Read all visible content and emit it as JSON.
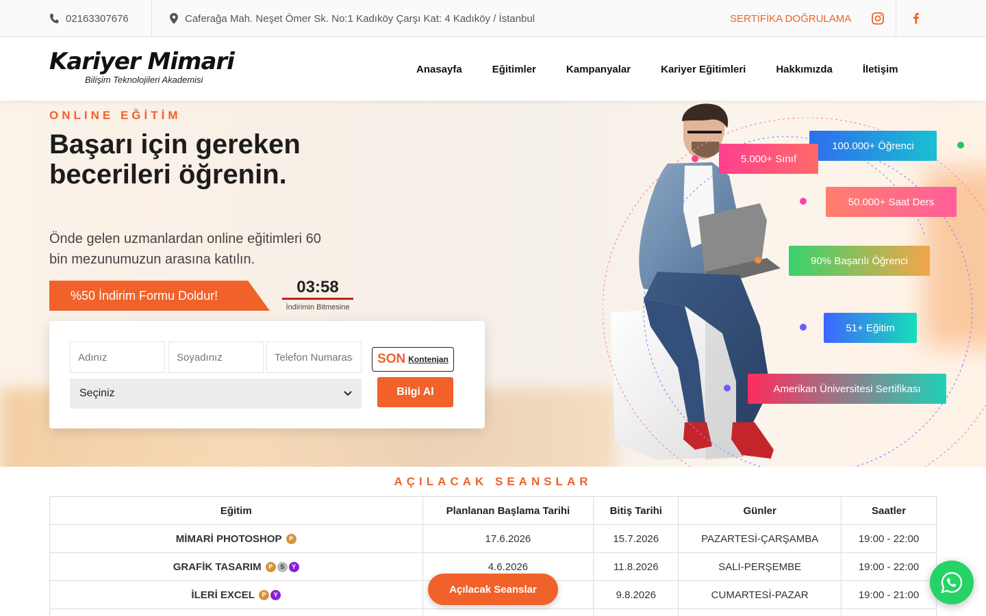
{
  "topbar": {
    "phone": "02163307676",
    "address": "Caferağa Mah. Neşet Ömer Sk. No:1 Kadıköy Çarşı Kat: 4 Kadıköy / İstanbul",
    "certificate_link": "SERTİFİKA DOĞRULAMA",
    "social_icons": [
      "instagram-icon",
      "facebook-icon"
    ]
  },
  "logo": {
    "brand": "Kariyer Mimari",
    "tagline": "Bilişim Teknolojileri Akademisi"
  },
  "nav": {
    "items": [
      "Anasayfa",
      "Eğitimler",
      "Kampanyalar",
      "Kariyer Eğitimleri",
      "Hakkımızda",
      "İletişim"
    ]
  },
  "hero": {
    "eyebrow": "ONLINE EĞİTİM",
    "headline": "Başarı için gereken becerileri öğrenin.",
    "subline": "Önde gelen uzmanlardan online eğitimleri 60 bin mezunumuzun arasına katılın.",
    "promo": "%50 İndirim Formu Doldur!",
    "timer": {
      "time": "03:58",
      "caption": "İndirimin Bitmesine"
    },
    "form": {
      "first_name_placeholder": "Adınız",
      "last_name_placeholder": "Soyadınız",
      "phone_placeholder": "Telefon Numarası",
      "select_value": "Seçiniz",
      "son_big": "SON",
      "son_small": "Kontenjan",
      "submit": "Bilgi Al"
    },
    "badges": [
      "100.000+ Öğrenci",
      "5.000+ Sınıf",
      "50.000+ Saat Ders",
      "90% Başarılı Öğrenci",
      "51+ Eğitim",
      "Amerikan Üniversitesi Sertifikası"
    ]
  },
  "sessions": {
    "title": "AÇILACAK SEANSLAR",
    "columns": [
      "Eğitim",
      "Planlanan Başlama Tarihi",
      "Bitiş Tarihi",
      "Günler",
      "Saatler"
    ],
    "rows": [
      {
        "name": "MİMARİ PHOTOSHOP",
        "tags": [
          "P"
        ],
        "start": "17.6.2026",
        "end": "15.7.2026",
        "days": "PAZARTESİ-ÇARŞAMBA",
        "hours": "19:00 - 22:00"
      },
      {
        "name": "GRAFİK TASARIM",
        "tags": [
          "P",
          "S",
          "Y"
        ],
        "start": "4.6.2026",
        "end": "11.8.2026",
        "days": "SALI-PERŞEMBE",
        "hours": "19:00 - 22:00"
      },
      {
        "name": "İLERİ EXCEL",
        "tags": [
          "P",
          "Y"
        ],
        "start": "",
        "end": "9.8.2026",
        "days": "CUMARTESİ-PAZAR",
        "hours": "19:00 - 21:00"
      }
    ],
    "floating_button": "Açılacak Seanslar"
  },
  "colors": {
    "accent": "#f0622a",
    "whatsapp": "#25d366",
    "timer_underline": "#c41e1e"
  }
}
